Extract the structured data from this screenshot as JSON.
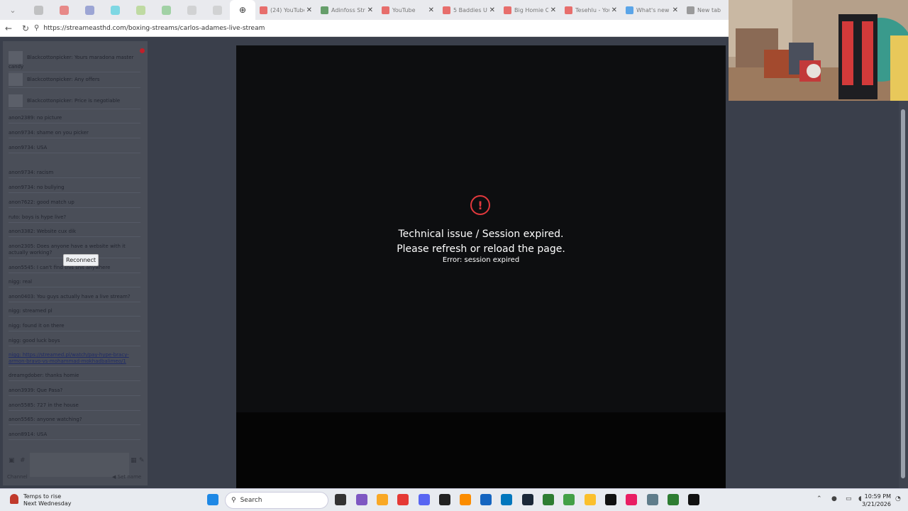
{
  "browser": {
    "tabs": [
      {
        "label": "(24) YouTube",
        "fav_color": "#e53935"
      },
      {
        "label": "Adinfoss Stre",
        "fav_color": "#2e7d32"
      },
      {
        "label": "YouTube",
        "fav_color": "#e53935"
      },
      {
        "label": "5 Baddies U",
        "fav_color": "#e53935"
      },
      {
        "label": "Big Homie C",
        "fav_color": "#e53935"
      },
      {
        "label": "Tesehlu - You",
        "fav_color": "#e53935"
      },
      {
        "label": "What's new o",
        "fav_color": "#1e88e5"
      },
      {
        "label": "New tab",
        "fav_color": "#777777"
      }
    ],
    "url": "https://streameasthd.com/boxing-streams/carlos-adames-live-stream"
  },
  "chat": {
    "messages": [
      {
        "text": "Blackcottonpicker: Yours maradona master candy",
        "avatar": true
      },
      {
        "text": "Blackcottonpicker: Any offers",
        "avatar": true
      },
      {
        "text": "Blackcottonpicker: Price is negotiable",
        "avatar": true
      },
      {
        "text": "anon2389: no picture"
      },
      {
        "text": "anon9734: shame on you picker"
      },
      {
        "text": "anon9734: USA"
      },
      {
        "text": "anon9734: racism"
      },
      {
        "text": "anon9734: no bullying"
      },
      {
        "text": "anon7622: good match up"
      },
      {
        "text": "ruto: boys is hype live?"
      },
      {
        "text": "anon3382: Website cux dik"
      },
      {
        "text": "anon2305: Does anyone have a website with it actually working?"
      },
      {
        "text": "anon5545: I can't find this shit anywhere"
      },
      {
        "text": "nigg: real"
      },
      {
        "text": "anon0403: You guys actually have a live stream?"
      },
      {
        "text": "nigg: streamed pl"
      },
      {
        "text": "nigg: found it on there"
      },
      {
        "text": "nigg: good luck boys"
      },
      {
        "text": "nigg: https://streamed.pl/watch/pay-hype-bracy-armon-bravo-vs-mohammad-mokhadbalimeo/1",
        "link": true
      },
      {
        "text": "dreamgdober: thanks homie"
      },
      {
        "text": "anon3939: Que Pasa?"
      },
      {
        "text": "anon5585: 727 in the house"
      },
      {
        "text": "anon5565: anyone watching?"
      },
      {
        "text": "anon8914: USA"
      }
    ],
    "reconnect_label": "Reconnect",
    "set_name_label": "Set name",
    "channel_label": "Channel",
    "colors": {
      "panel": "#4a4e58",
      "alert_dot": "#c0202a"
    }
  },
  "player": {
    "error_title_line1": "Technical issue / Session expired.",
    "error_title_line2": "Please refresh or reload the page.",
    "error_detail": "Error: session expired",
    "error_icon": "exclamation-circle-icon",
    "colors": {
      "background": "#0d0e10",
      "icon": "#e2393d",
      "text": "#ffffff"
    }
  },
  "taskbar": {
    "weather_line1": "Temps to rise",
    "weather_line2": "Next Wednesday",
    "search_placeholder": "Search",
    "time": "10:59 PM",
    "date": "3/21/2026"
  }
}
